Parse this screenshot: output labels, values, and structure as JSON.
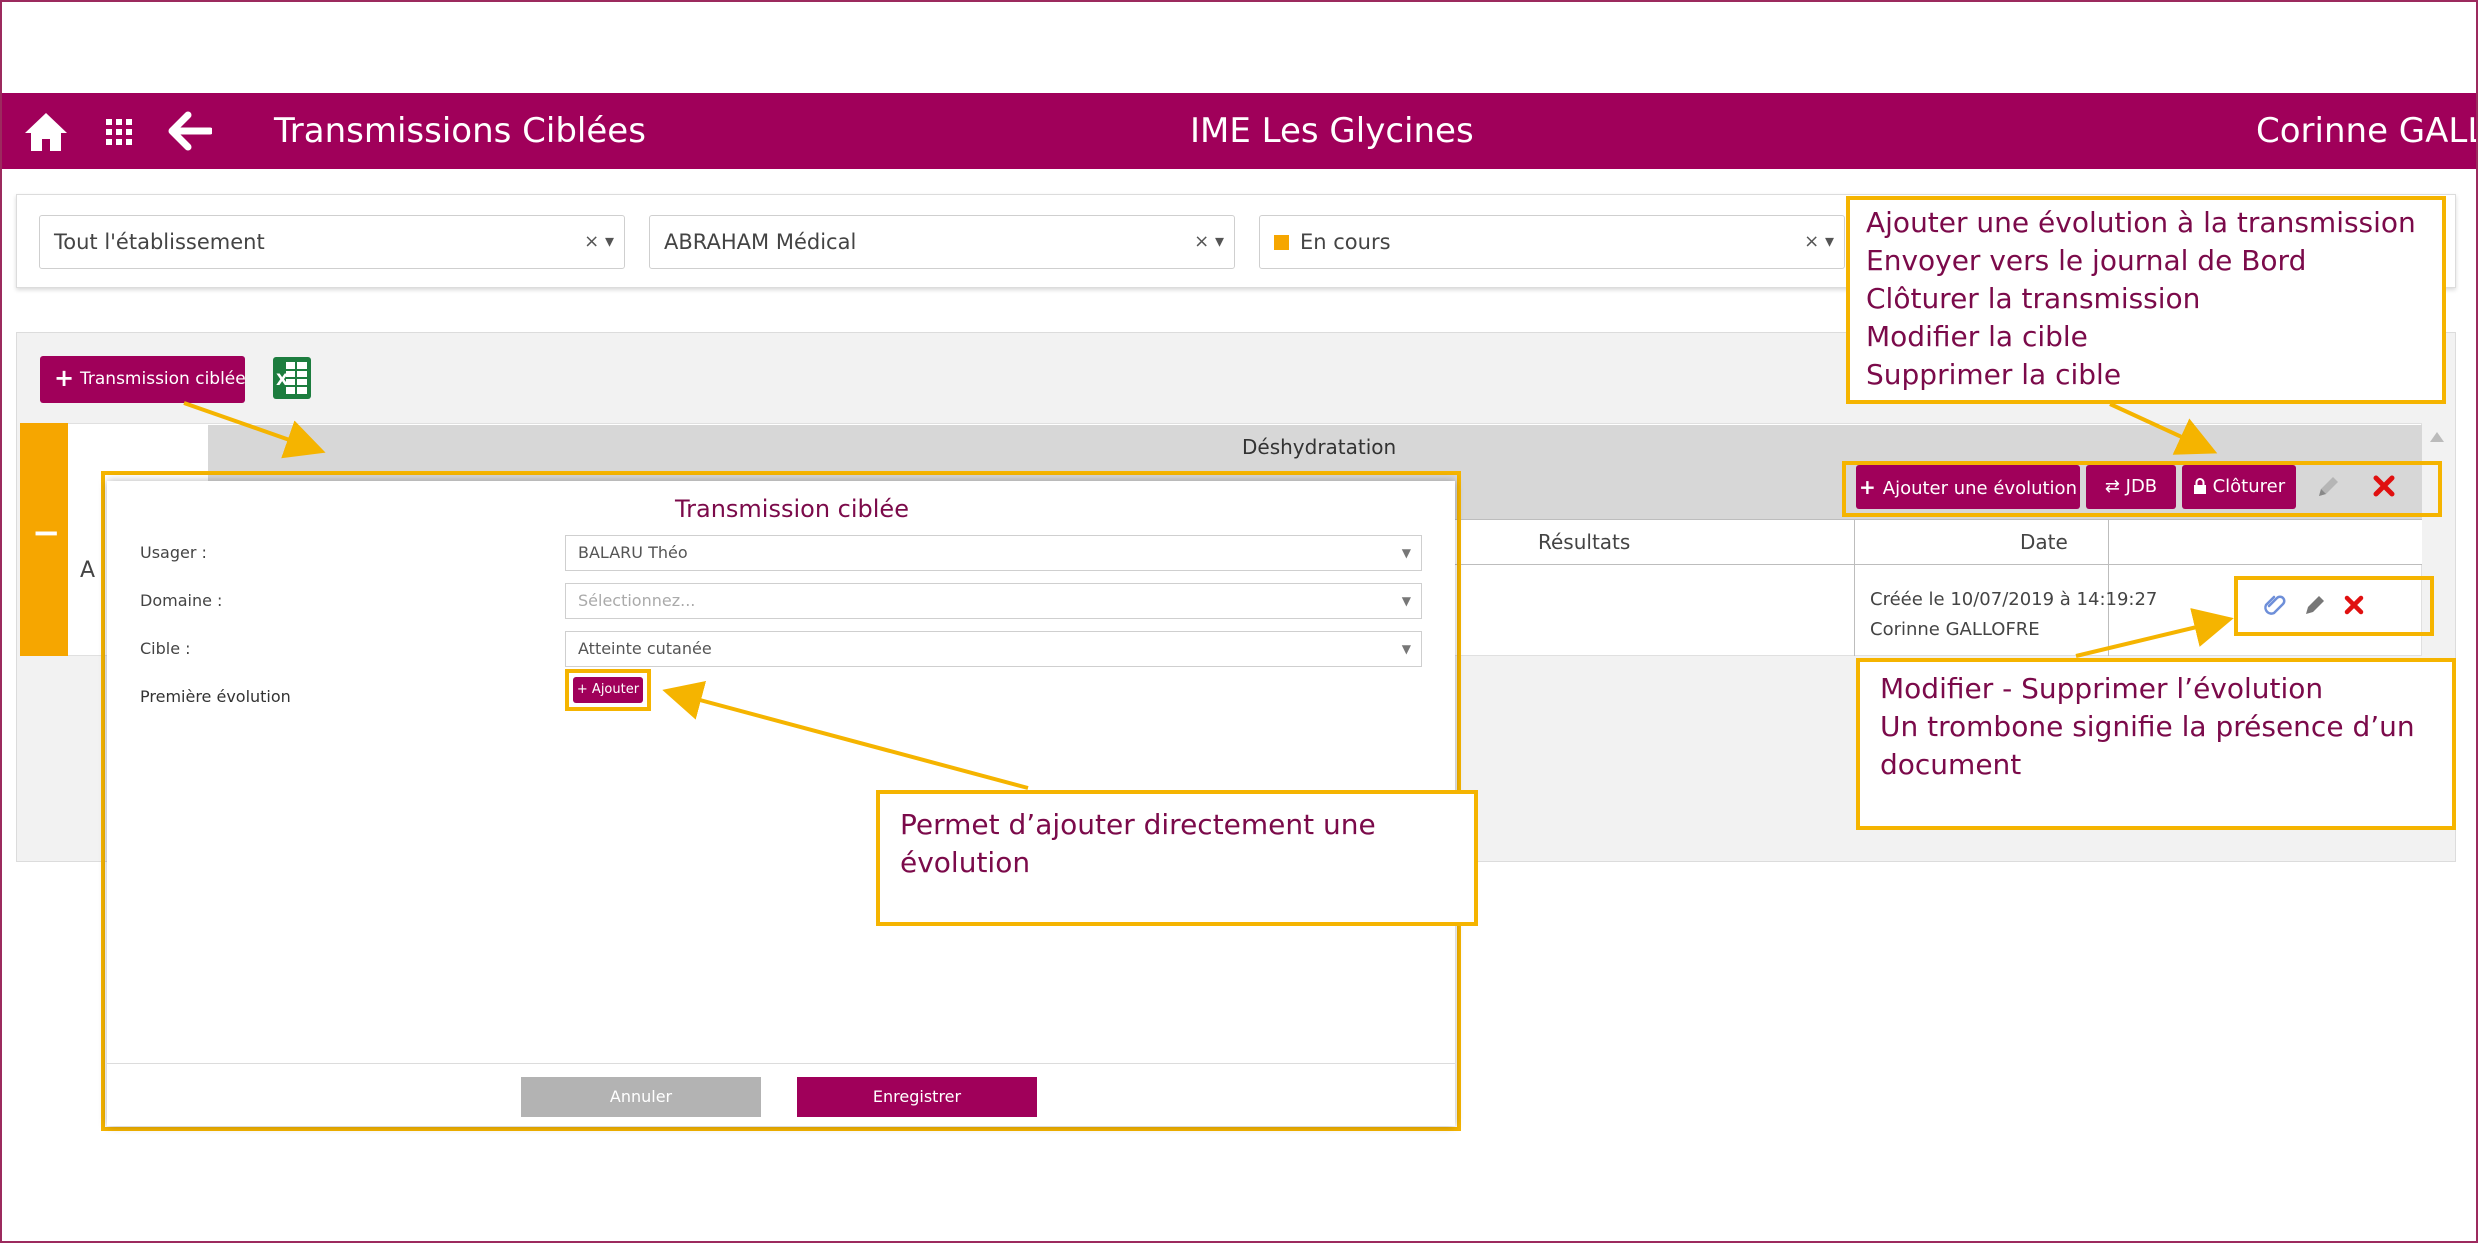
{
  "header": {
    "app_title": "Transmissions Ciblées",
    "establishment": "IME Les Glycines",
    "user": "Corinne GALL"
  },
  "filters": [
    {
      "value": "Tout l'établissement",
      "clear": "× ▾"
    },
    {
      "value": "ABRAHAM Médical",
      "clear": "× ▾"
    },
    {
      "value": "En cours",
      "clear": "× ▾",
      "status_color": "#f6a600"
    }
  ],
  "toolbar": {
    "add_transmission_label": "Transmission ciblée",
    "excel_icon": "excel-icon"
  },
  "card": {
    "collapse_symbol": "−",
    "avatar_initial": "A",
    "target_title": "Déshydratation",
    "columns": {
      "results": "Résultats",
      "date": "Date"
    },
    "created": "Créée le 10/07/2019 à 14:19:27",
    "author": "Corinne GALLOFRE"
  },
  "actions": {
    "add_evolution": "Ajouter une évolution",
    "jdb": "JDB",
    "close": "Clôturer"
  },
  "callouts": {
    "top_right": [
      "Ajouter une évolution à la transmission",
      "Envoyer vers le journal de Bord",
      "Clôturer la transmission",
      "Modifier la cible",
      "Supprimer la cible"
    ],
    "evolution": [
      "Modifier - Supprimer l’évolution",
      "Un trombone signifie la présence d’un",
      "document"
    ],
    "add_direct": [
      "Permet d’ajouter directement une",
      "évolution"
    ]
  },
  "modal": {
    "title": "Transmission ciblée",
    "usager_label": "Usager :",
    "usager_value": "BALARU Théo",
    "domaine_label": "Domaine :",
    "domaine_placeholder": "Sélectionnez...",
    "cible_label": "Cible :",
    "cible_value": "Atteinte cutanée",
    "premiere_label": "Première évolution",
    "ajouter_label": "+ Ajouter",
    "cancel_label": "Annuler",
    "save_label": "Enregistrer"
  },
  "colors": {
    "brand": "#a0005a",
    "highlight": "#f5b400",
    "status_in_progress": "#f6a600",
    "delete": "#e01010"
  }
}
